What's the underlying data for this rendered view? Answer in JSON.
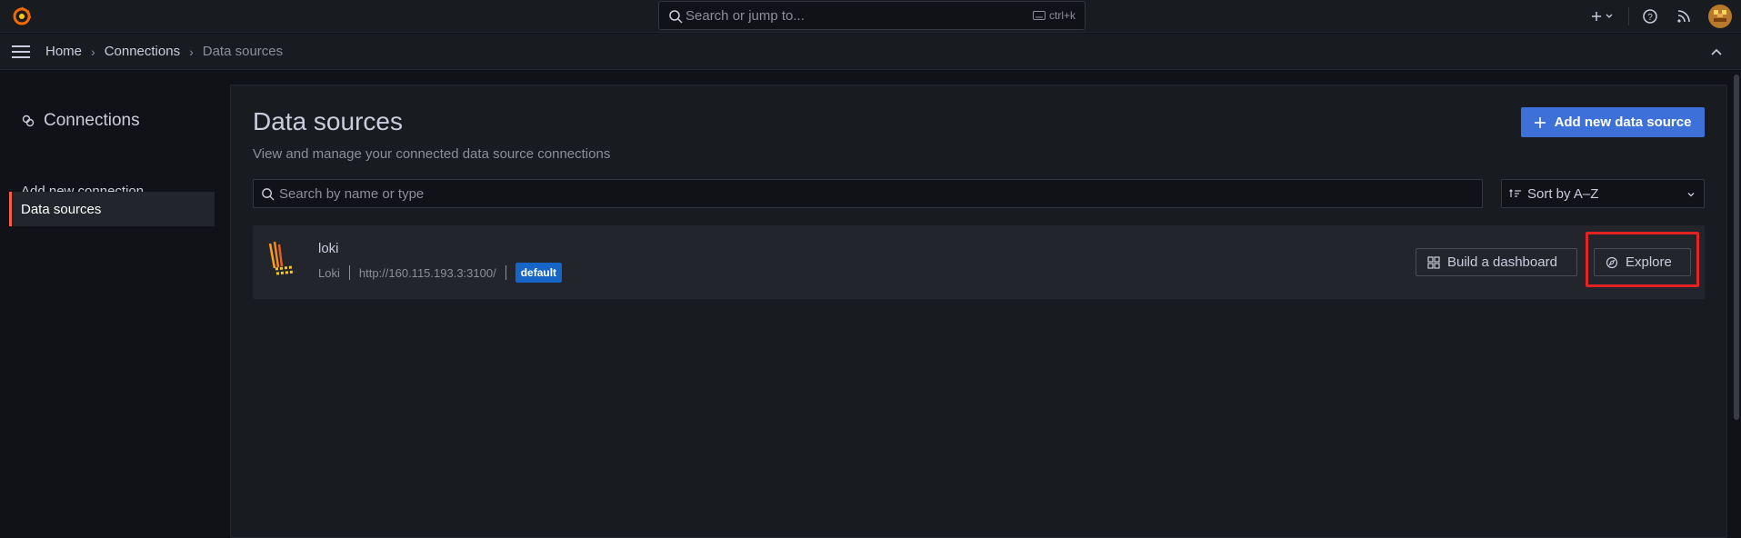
{
  "topbar": {
    "search_placeholder": "Search or jump to...",
    "search_shortcut": "ctrl+k"
  },
  "breadcrumb": {
    "items": [
      "Home",
      "Connections",
      "Data sources"
    ]
  },
  "sidebar": {
    "title": "Connections",
    "items": [
      {
        "label": "Add new connection",
        "active": false
      },
      {
        "label": "Data sources",
        "active": true
      }
    ]
  },
  "main": {
    "title": "Data sources",
    "subtitle": "View and manage your connected data source connections",
    "add_button_label": "Add new data source",
    "search_placeholder": "Search by name or type",
    "sort_label": "Sort by A–Z"
  },
  "datasources": [
    {
      "name": "loki",
      "type": "Loki",
      "url": "http://160.115.193.3:3100/",
      "badge": "default",
      "build_label": "Build a dashboard",
      "explore_label": "Explore"
    }
  ],
  "colors": {
    "accent": "#3d71d9",
    "badge": "#1666c7",
    "active_indicator": "#f55f3e",
    "highlight": "#e32222"
  }
}
